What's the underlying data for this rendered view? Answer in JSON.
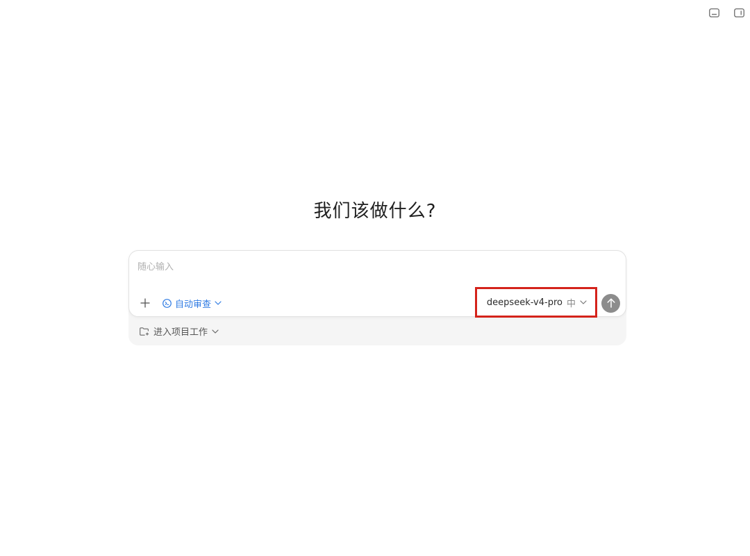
{
  "window": {
    "controls": [
      {
        "icon": "panel-bottom-icon"
      },
      {
        "icon": "panel-right-icon"
      }
    ]
  },
  "main": {
    "heading": "我们该做什么?"
  },
  "composer": {
    "placeholder": "随心输入",
    "value": "",
    "review_label": "自动审查",
    "model_name": "deepseek-v4-pro",
    "model_level": "中",
    "accent_color": "#2f7be3",
    "highlight_color": "#d4231b"
  },
  "project": {
    "label": "进入项目工作"
  }
}
